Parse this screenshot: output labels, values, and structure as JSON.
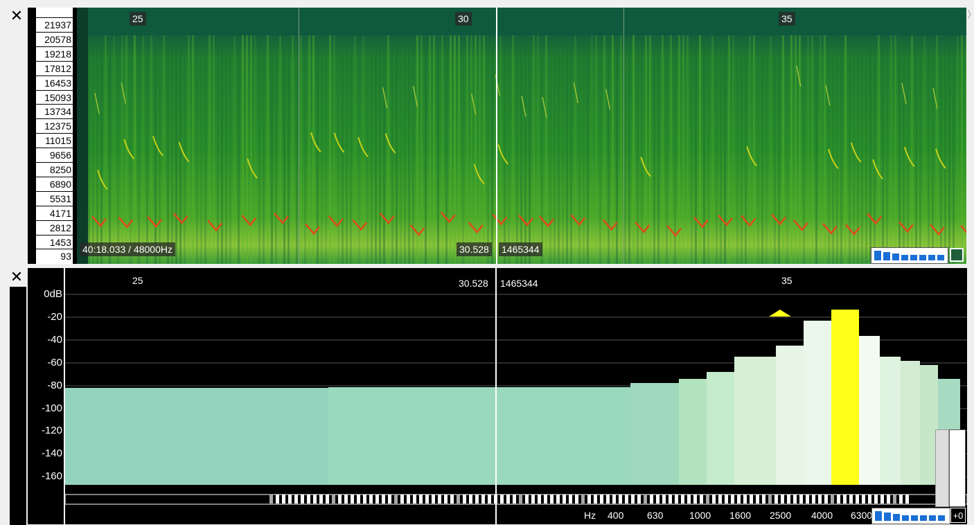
{
  "spectrogram": {
    "close_icon": "close-icon",
    "freq_ticks": [
      "21937",
      "20578",
      "19218",
      "17812",
      "16453",
      "15093",
      "13734",
      "12375",
      "11015",
      "9656",
      "8250",
      "6890",
      "5531",
      "4171",
      "2812",
      "1453",
      "93"
    ],
    "time_ticks": [
      "25",
      "30",
      "35"
    ],
    "position_label": "40:18.033 / 48000Hz",
    "cursor_time": "30.528",
    "cursor_sample": "1465344",
    "chevron_icon": "chevron-right-icon"
  },
  "spectrum": {
    "close_icon": "close-icon",
    "db_ticks": [
      "0dB",
      "-20",
      "-40",
      "-60",
      "-80",
      "-100",
      "-120",
      "-140",
      "-160"
    ],
    "time_ticks": [
      "25",
      "35"
    ],
    "cursor_time": "30.528",
    "cursor_sample": "1465344",
    "hz_unit": "Hz",
    "hz_ticks": [
      "400",
      "630",
      "1000",
      "1600",
      "2500",
      "4000",
      "6300"
    ],
    "plus_label": "+0"
  },
  "colors": {
    "spectrum_fill": "#93d2bd",
    "peak": "#ffff1a",
    "spectrogram_base": "#1f8a2a"
  }
}
